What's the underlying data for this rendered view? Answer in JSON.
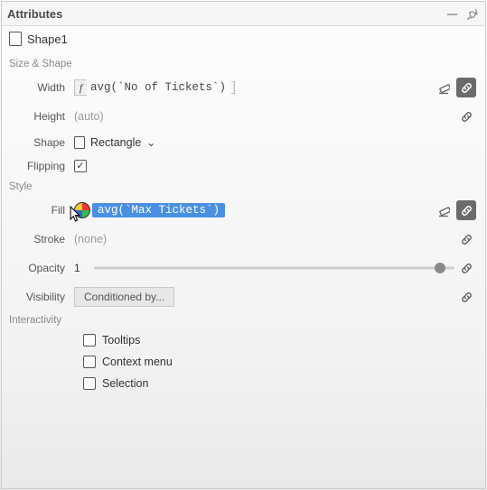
{
  "panel": {
    "title": "Attributes"
  },
  "object": {
    "name": "Shape1"
  },
  "sections": {
    "size_shape": "Size & Shape",
    "style": "Style",
    "interactivity": "Interactivity"
  },
  "labels": {
    "width": "Width",
    "height": "Height",
    "shape": "Shape",
    "flipping": "Flipping",
    "fill": "Fill",
    "stroke": "Stroke",
    "opacity": "Opacity",
    "visibility": "Visibility"
  },
  "values": {
    "width_expr": "avg(`No of Tickets`)",
    "height_placeholder": "(auto)",
    "shape_name": "Rectangle",
    "flipping_checked": true,
    "fill_expr": "avg(`Max Tickets`)",
    "stroke_placeholder": "(none)",
    "opacity": "1",
    "opacity_slider_pct": 96,
    "visibility_button": "Conditioned by..."
  },
  "interactivity": {
    "tooltips": {
      "label": "Tooltips",
      "checked": false
    },
    "context_menu": {
      "label": "Context menu",
      "checked": false
    },
    "selection": {
      "label": "Selection",
      "checked": false
    }
  }
}
